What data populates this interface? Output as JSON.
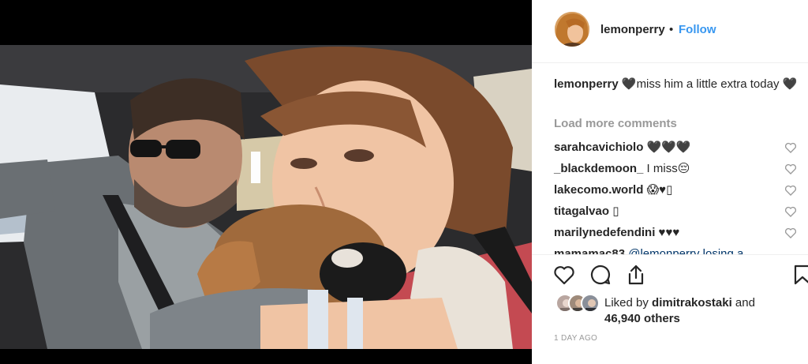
{
  "post": {
    "photo_alt": "selfie in a car with a puppy"
  },
  "header": {
    "username": "lemonperry",
    "dot": "•",
    "follow_label": "Follow"
  },
  "caption": {
    "username": "lemonperry",
    "heart": "🖤",
    "text": "miss him a little extra today",
    "trailing_heart": "🖤"
  },
  "load_more_label": "Load more comments",
  "comments": [
    {
      "username": "sarahcavichiolo",
      "text": "🖤🖤🖤"
    },
    {
      "username": "_blackdemoon_",
      "text": "I miss😔"
    },
    {
      "username": "lakecomo.world",
      "text": "😱♥▯"
    },
    {
      "username": "titagalvao",
      "text": "▯"
    },
    {
      "username": "marilynedefendini",
      "text": "♥♥♥"
    },
    {
      "username": "mamamac83",
      "text": "@lemonperry losing a"
    }
  ],
  "likes": {
    "liked_by_prefix": "Liked by ",
    "liked_by_user": "dimitrakostaki",
    "and": " and",
    "count": "46,940 others"
  },
  "timestamp": "1 DAY AGO",
  "colors": {
    "accent": "#3897f0",
    "text": "#262626",
    "muted": "#999999",
    "border": "#efefef"
  },
  "icons": [
    "heart-icon",
    "comment-icon",
    "share-icon",
    "bookmark-icon"
  ]
}
